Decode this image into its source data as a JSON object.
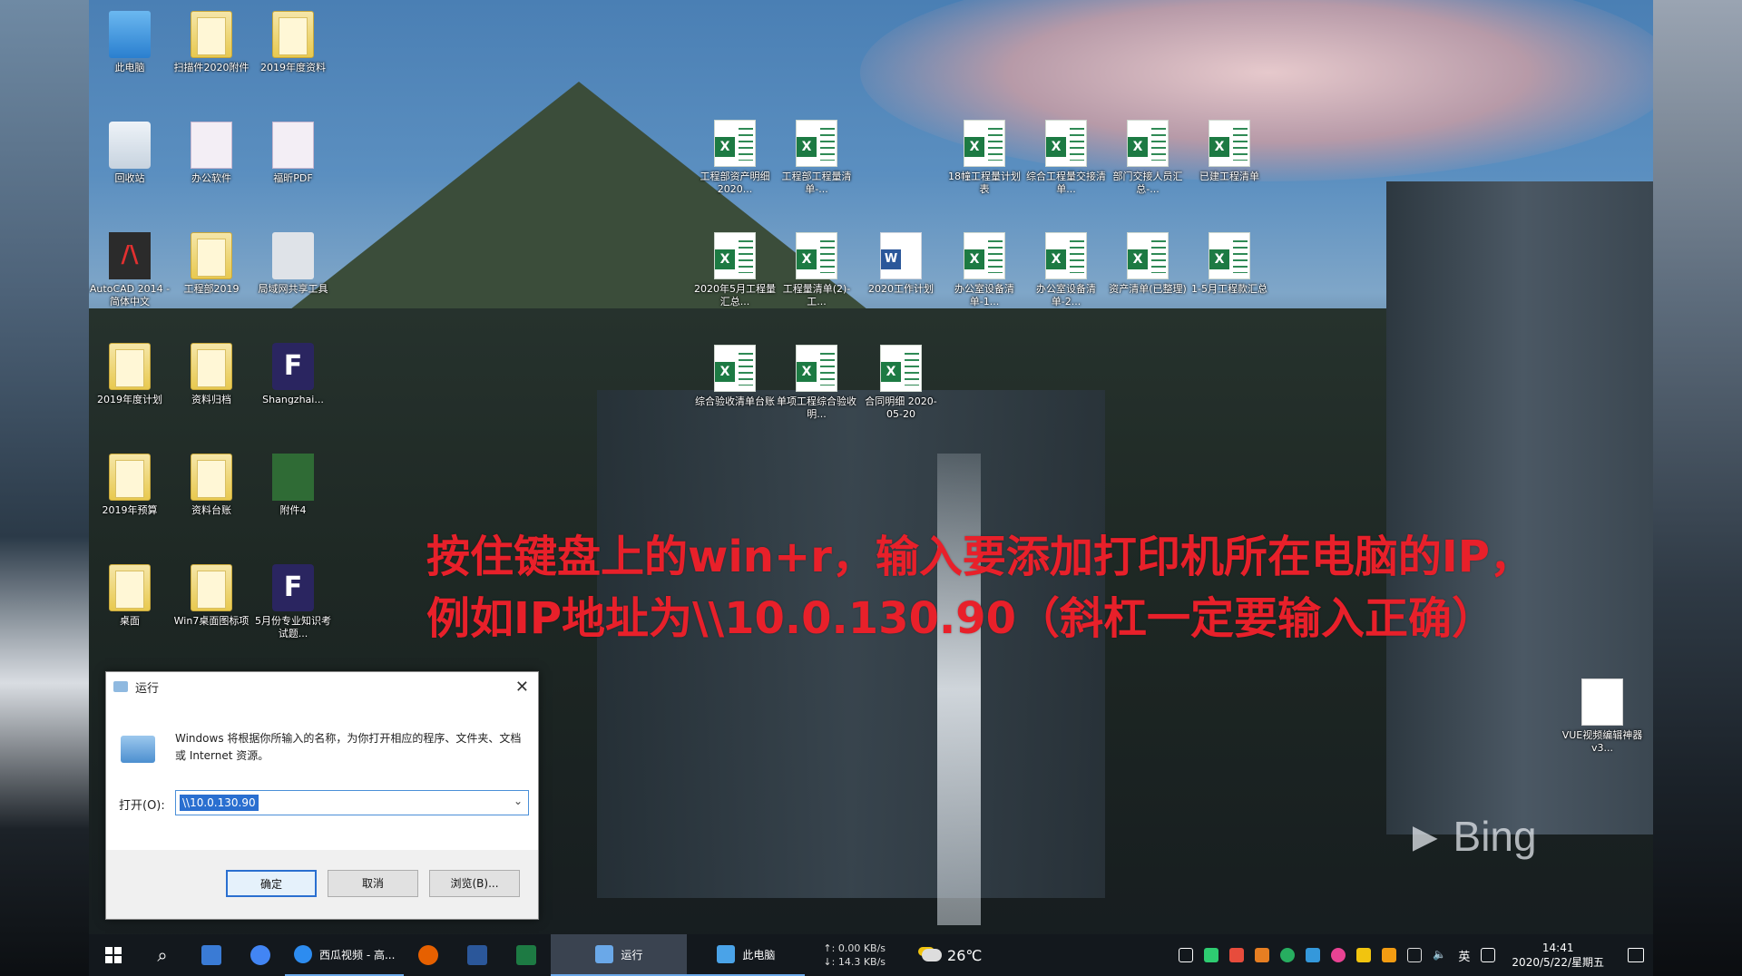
{
  "desktop_icons": [
    {
      "label": "此电脑",
      "type": "pc"
    },
    {
      "label": "扫描件2020附件",
      "type": "folder"
    },
    {
      "label": "2019年度资料",
      "type": "folder"
    },
    {
      "label": "回收站",
      "type": "recycle"
    },
    {
      "label": "办公软件",
      "type": "doc"
    },
    {
      "label": "福昕PDF",
      "type": "doc"
    },
    {
      "label": "AutoCAD 2014 - 简体中文",
      "type": "app-red"
    },
    {
      "label": "工程部2019",
      "type": "folder"
    },
    {
      "label": "局域网共享工具",
      "type": "gray"
    },
    {
      "label": "2019年度计划",
      "type": "folder"
    },
    {
      "label": "资料归档",
      "type": "folder"
    },
    {
      "label": "Shangzhai...",
      "type": "app"
    },
    {
      "label": "2019年预算",
      "type": "folder"
    },
    {
      "label": "资料台账",
      "type": "folder"
    },
    {
      "label": "附件4",
      "type": "green"
    },
    {
      "label": "桌面",
      "type": "folder"
    },
    {
      "label": "Win7桌面图标项",
      "type": "folder"
    },
    {
      "label": "5月份专业知识考试题...",
      "type": "app"
    }
  ],
  "excel_icons": [
    {
      "label": "工程部资产明细2020...",
      "type": "excel"
    },
    {
      "label": "工程部工程量清单-...",
      "type": "excel"
    },
    {
      "label": "18幢工程量计划表",
      "type": "excel"
    },
    {
      "label": "综合工程量交接清单...",
      "type": "excel"
    },
    {
      "label": "部门交接人员汇总-...",
      "type": "excel"
    },
    {
      "label": "已建工程清单",
      "type": "excel"
    },
    {
      "label": "2020年5月工程量汇总...",
      "type": "excel"
    },
    {
      "label": "工程量清单(2)-工...",
      "type": "excel"
    },
    {
      "label": "2020工作计划",
      "type": "word"
    },
    {
      "label": "办公室设备清单-1...",
      "type": "excel"
    },
    {
      "label": "办公室设备清单-2...",
      "type": "excel"
    },
    {
      "label": "资产清单(已整理)",
      "type": "excel"
    },
    {
      "label": "1-5月工程款汇总",
      "type": "excel"
    },
    {
      "label": "综合验收清单台账",
      "type": "excel"
    },
    {
      "label": "单项工程综合验收明...",
      "type": "excel"
    },
    {
      "label": "合同明细 2020-05-20",
      "type": "excel"
    }
  ],
  "overlay": {
    "line1": "按住键盘上的win+r，输入要添加打印机所在电脑的IP，",
    "line2": "例如IP地址为\\\\10.0.130.90（斜杠一定要输入正确）"
  },
  "watermark": "Bing",
  "vue_icon": {
    "label": "VUE视频编辑神器 v3..."
  },
  "run_dialog": {
    "title": "运行",
    "description": "Windows 将根据你所输入的名称，为你打开相应的程序、文件夹、文档或 Internet 资源。",
    "open_label": "打开(O):",
    "open_value": "\\\\10.0.130.90",
    "ok_label": "确定",
    "cancel_label": "取消",
    "browse_label": "浏览(B)..."
  },
  "taskbar": {
    "apps": [
      {
        "label": "西瓜视频 - 高...",
        "color": "#2d8cf0"
      },
      {
        "label": "运行",
        "color": "#6aa8e8"
      },
      {
        "label": "此电脑",
        "color": "#4aa3e8"
      }
    ],
    "net_up": "↑: 0.00 KB/s",
    "net_down": "↓: 14.3 KB/s",
    "temperature": "26℃",
    "lang": "英",
    "time": "14:41",
    "date": "2020/5/22/星期五"
  }
}
